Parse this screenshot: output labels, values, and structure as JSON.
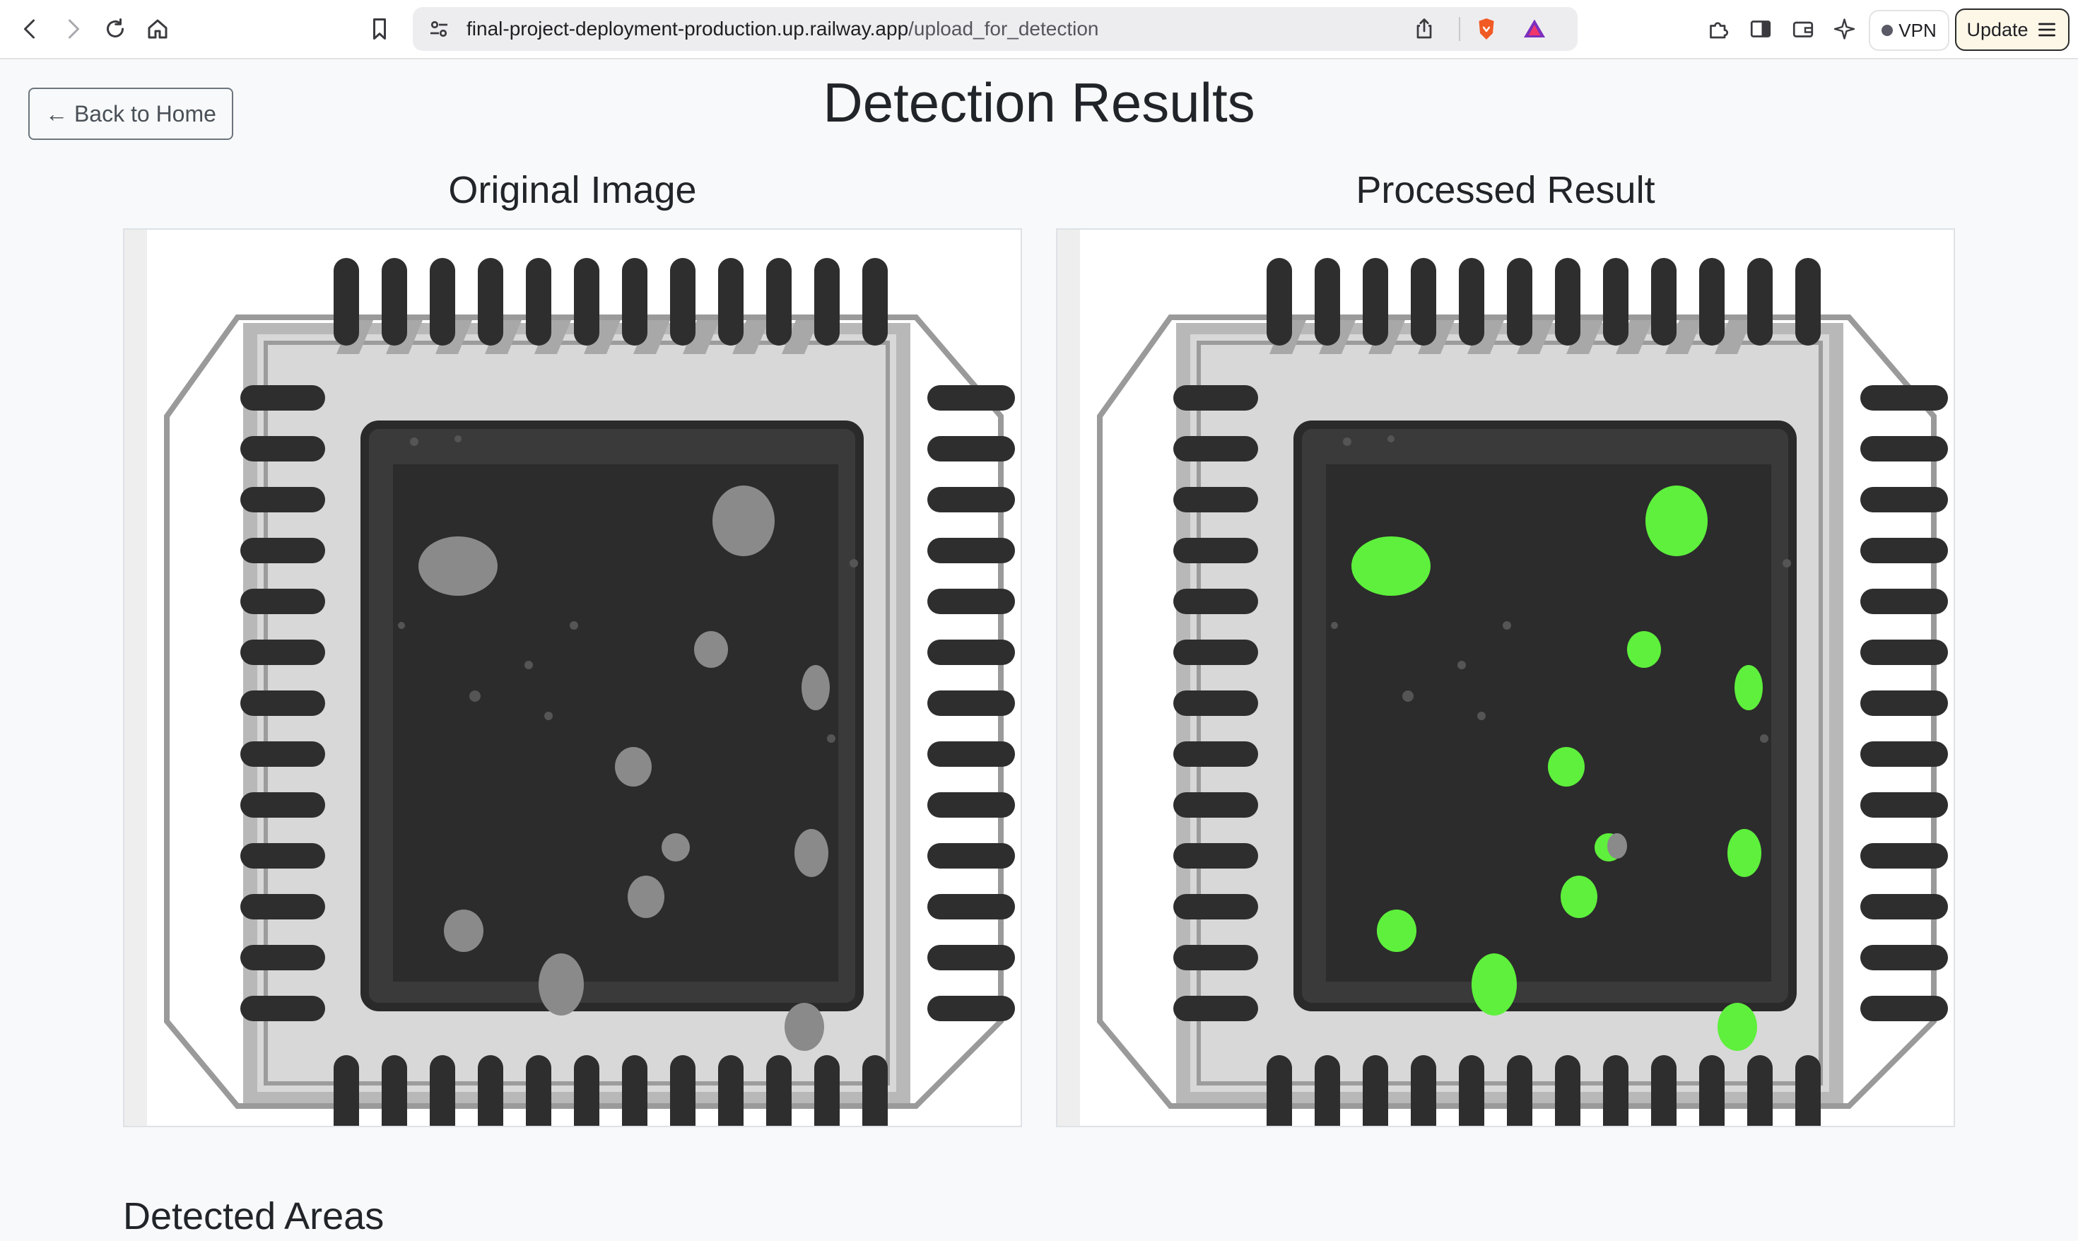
{
  "browser": {
    "url_host": "final-project-deployment-production.up.railway.app",
    "url_path": "/upload_for_detection",
    "vpn_label": "VPN",
    "update_label": "Update"
  },
  "page": {
    "back_label": "← Back to Home",
    "title": "Detection Results",
    "original_title": "Original Image",
    "processed_title": "Processed Result",
    "section_title": "Detected Areas"
  },
  "colors": {
    "defect_original": "#8a8a8a",
    "defect_highlight": "#5ef03c"
  }
}
